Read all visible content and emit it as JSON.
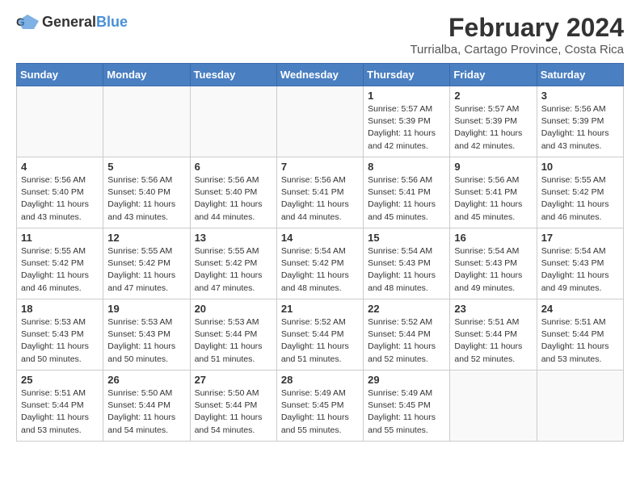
{
  "header": {
    "logo_general": "General",
    "logo_blue": "Blue",
    "main_title": "February 2024",
    "subtitle": "Turrialba, Cartago Province, Costa Rica"
  },
  "calendar": {
    "days_of_week": [
      "Sunday",
      "Monday",
      "Tuesday",
      "Wednesday",
      "Thursday",
      "Friday",
      "Saturday"
    ],
    "weeks": [
      [
        {
          "day": "",
          "info": ""
        },
        {
          "day": "",
          "info": ""
        },
        {
          "day": "",
          "info": ""
        },
        {
          "day": "",
          "info": ""
        },
        {
          "day": "1",
          "info": "Sunrise: 5:57 AM\nSunset: 5:39 PM\nDaylight: 11 hours\nand 42 minutes."
        },
        {
          "day": "2",
          "info": "Sunrise: 5:57 AM\nSunset: 5:39 PM\nDaylight: 11 hours\nand 42 minutes."
        },
        {
          "day": "3",
          "info": "Sunrise: 5:56 AM\nSunset: 5:39 PM\nDaylight: 11 hours\nand 43 minutes."
        }
      ],
      [
        {
          "day": "4",
          "info": "Sunrise: 5:56 AM\nSunset: 5:40 PM\nDaylight: 11 hours\nand 43 minutes."
        },
        {
          "day": "5",
          "info": "Sunrise: 5:56 AM\nSunset: 5:40 PM\nDaylight: 11 hours\nand 43 minutes."
        },
        {
          "day": "6",
          "info": "Sunrise: 5:56 AM\nSunset: 5:40 PM\nDaylight: 11 hours\nand 44 minutes."
        },
        {
          "day": "7",
          "info": "Sunrise: 5:56 AM\nSunset: 5:41 PM\nDaylight: 11 hours\nand 44 minutes."
        },
        {
          "day": "8",
          "info": "Sunrise: 5:56 AM\nSunset: 5:41 PM\nDaylight: 11 hours\nand 45 minutes."
        },
        {
          "day": "9",
          "info": "Sunrise: 5:56 AM\nSunset: 5:41 PM\nDaylight: 11 hours\nand 45 minutes."
        },
        {
          "day": "10",
          "info": "Sunrise: 5:55 AM\nSunset: 5:42 PM\nDaylight: 11 hours\nand 46 minutes."
        }
      ],
      [
        {
          "day": "11",
          "info": "Sunrise: 5:55 AM\nSunset: 5:42 PM\nDaylight: 11 hours\nand 46 minutes."
        },
        {
          "day": "12",
          "info": "Sunrise: 5:55 AM\nSunset: 5:42 PM\nDaylight: 11 hours\nand 47 minutes."
        },
        {
          "day": "13",
          "info": "Sunrise: 5:55 AM\nSunset: 5:42 PM\nDaylight: 11 hours\nand 47 minutes."
        },
        {
          "day": "14",
          "info": "Sunrise: 5:54 AM\nSunset: 5:42 PM\nDaylight: 11 hours\nand 48 minutes."
        },
        {
          "day": "15",
          "info": "Sunrise: 5:54 AM\nSunset: 5:43 PM\nDaylight: 11 hours\nand 48 minutes."
        },
        {
          "day": "16",
          "info": "Sunrise: 5:54 AM\nSunset: 5:43 PM\nDaylight: 11 hours\nand 49 minutes."
        },
        {
          "day": "17",
          "info": "Sunrise: 5:54 AM\nSunset: 5:43 PM\nDaylight: 11 hours\nand 49 minutes."
        }
      ],
      [
        {
          "day": "18",
          "info": "Sunrise: 5:53 AM\nSunset: 5:43 PM\nDaylight: 11 hours\nand 50 minutes."
        },
        {
          "day": "19",
          "info": "Sunrise: 5:53 AM\nSunset: 5:43 PM\nDaylight: 11 hours\nand 50 minutes."
        },
        {
          "day": "20",
          "info": "Sunrise: 5:53 AM\nSunset: 5:44 PM\nDaylight: 11 hours\nand 51 minutes."
        },
        {
          "day": "21",
          "info": "Sunrise: 5:52 AM\nSunset: 5:44 PM\nDaylight: 11 hours\nand 51 minutes."
        },
        {
          "day": "22",
          "info": "Sunrise: 5:52 AM\nSunset: 5:44 PM\nDaylight: 11 hours\nand 52 minutes."
        },
        {
          "day": "23",
          "info": "Sunrise: 5:51 AM\nSunset: 5:44 PM\nDaylight: 11 hours\nand 52 minutes."
        },
        {
          "day": "24",
          "info": "Sunrise: 5:51 AM\nSunset: 5:44 PM\nDaylight: 11 hours\nand 53 minutes."
        }
      ],
      [
        {
          "day": "25",
          "info": "Sunrise: 5:51 AM\nSunset: 5:44 PM\nDaylight: 11 hours\nand 53 minutes."
        },
        {
          "day": "26",
          "info": "Sunrise: 5:50 AM\nSunset: 5:44 PM\nDaylight: 11 hours\nand 54 minutes."
        },
        {
          "day": "27",
          "info": "Sunrise: 5:50 AM\nSunset: 5:44 PM\nDaylight: 11 hours\nand 54 minutes."
        },
        {
          "day": "28",
          "info": "Sunrise: 5:49 AM\nSunset: 5:45 PM\nDaylight: 11 hours\nand 55 minutes."
        },
        {
          "day": "29",
          "info": "Sunrise: 5:49 AM\nSunset: 5:45 PM\nDaylight: 11 hours\nand 55 minutes."
        },
        {
          "day": "",
          "info": ""
        },
        {
          "day": "",
          "info": ""
        }
      ]
    ]
  }
}
